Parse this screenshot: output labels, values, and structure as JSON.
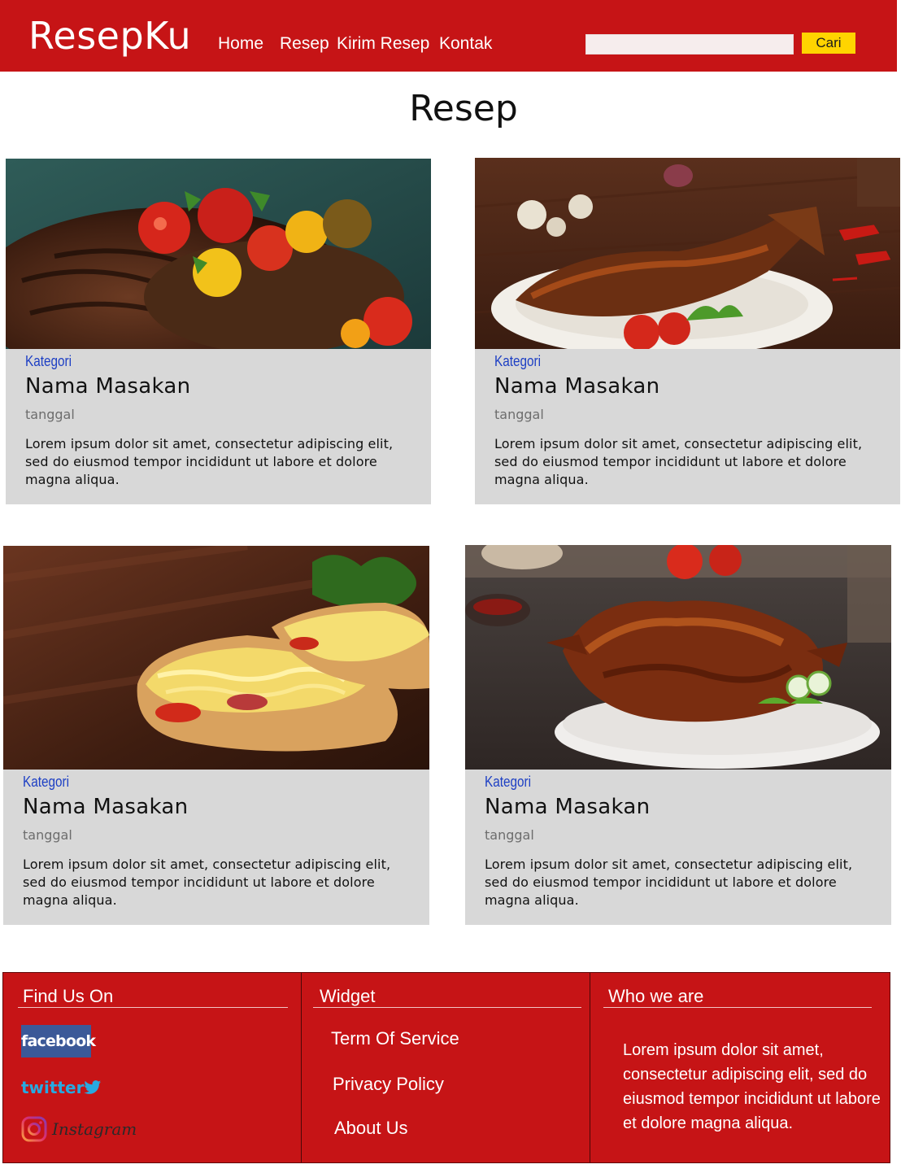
{
  "header": {
    "logo": "ResepKu",
    "nav": [
      "Home",
      "Resep",
      "Kirim Resep",
      "Kontak"
    ],
    "search_placeholder": "",
    "search_button": "Cari",
    "color": "#c61416"
  },
  "page_title": "Resep",
  "cards": [
    {
      "image": "grilled-steak-tomatoes",
      "category": "Kategori",
      "title": "Nama Masakan",
      "date": "tanggal",
      "description": "Lorem ipsum dolor sit amet, consectetur adipiscing elit, sed do eiusmod tempor incididunt ut labore et dolore magna aliqua."
    },
    {
      "image": "grilled-fish-plate",
      "category": "Kategori",
      "title": "Nama Masakan",
      "date": "tanggal",
      "description": "Lorem ipsum dolor sit amet, consectetur adipiscing elit, sed do eiusmod tempor incididunt ut labore et dolore magna aliqua."
    },
    {
      "image": "cheese-bruschetta",
      "category": "Kategori",
      "title": "Nama Masakan",
      "date": "tanggal",
      "description": "Lorem ipsum dolor sit amet, consectetur adipiscing elit, sed do eiusmod tempor incididunt ut labore et dolore magna aliqua."
    },
    {
      "image": "grilled-chicken-plate",
      "category": "Kategori",
      "title": "Nama Masakan",
      "date": "tanggal",
      "description": "Lorem ipsum dolor sit amet, consectetur adipiscing elit, sed do eiusmod tempor incididunt ut labore et dolore magna aliqua."
    }
  ],
  "footer": {
    "find_us_heading": "Find Us On",
    "social": {
      "facebook": "facebook",
      "twitter": "twitter",
      "instagram": "Instagram"
    },
    "widget_heading": "Widget",
    "widget_links": [
      "Term Of Service",
      "Privacy Policy",
      "About Us"
    ],
    "who_heading": "Who we are",
    "who_text": "Lorem ipsum dolor sit amet, consectetur adipiscing elit, sed do eiusmod tempor incididunt ut labore et dolore magna aliqua."
  },
  "colors": {
    "brand_red": "#c61416",
    "search_button": "#ffd400",
    "card_bg": "#d8d8d8",
    "category_blue": "#1d3fc4"
  }
}
